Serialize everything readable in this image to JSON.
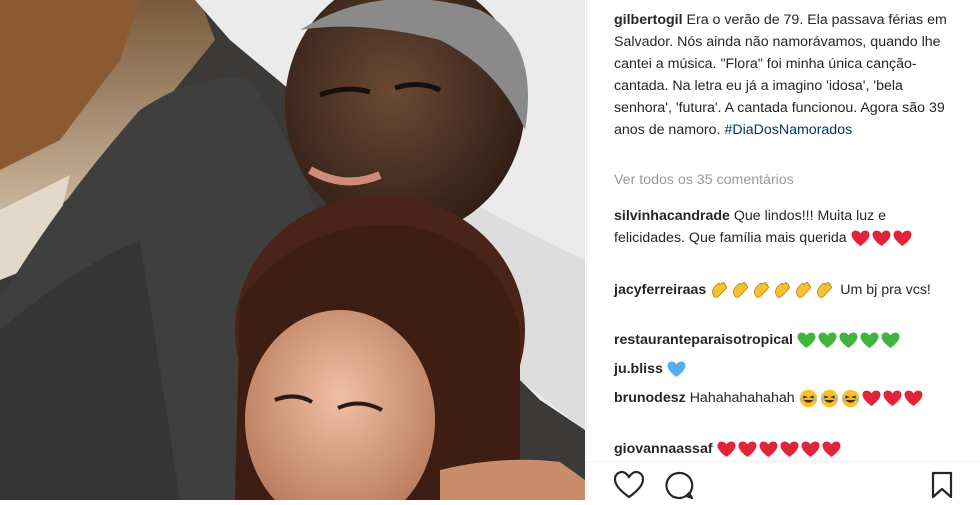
{
  "post": {
    "author": "gilbertogil",
    "caption": "Era o verão de 79. Ela passava férias em Salvador. Nós ainda não namorávamos, quando lhe cantei a música. \"Flora\" foi minha única canção-cantada. Na letra eu já a imagino 'idosa', 'bela senhora', 'futura'. A cantada funcionou. Agora são 39 anos de namoro.",
    "hashtag": "#DiaDosNamorados",
    "view_all_comments": "Ver todos os 35 comentários"
  },
  "comments": [
    {
      "user": "silvinhacandrade",
      "text": "Que lindos!!! Muita luz e felicidades. Que família mais querida",
      "emojis": [
        "red-heart",
        "red-heart",
        "red-heart"
      ]
    },
    {
      "user": "jacyferreiraas",
      "emojis_before": [
        "clapping-hands",
        "clapping-hands",
        "clapping-hands",
        "clapping-hands",
        "clapping-hands",
        "clapping-hands"
      ],
      "text": "Um bj pra vcs!"
    },
    {
      "user": "restauranteparaisotropical",
      "emojis": [
        "green-heart",
        "green-heart",
        "green-heart",
        "green-heart",
        "green-heart"
      ]
    },
    {
      "user": "ju.bliss",
      "emojis": [
        "blue-heart"
      ]
    },
    {
      "user": "brunodesz",
      "text": "Hahahahahahah",
      "emojis": [
        "laughing-face",
        "laughing-face",
        "laughing-face",
        "red-heart",
        "red-heart",
        "red-heart"
      ]
    },
    {
      "user": "giovannaassaf",
      "emojis": [
        "red-heart",
        "red-heart",
        "red-heart",
        "red-heart",
        "red-heart",
        "red-heart"
      ]
    }
  ],
  "actions": {
    "like": "heart-outline-icon",
    "comment": "speech-bubble-icon",
    "save": "bookmark-icon"
  },
  "colors": {
    "username": "#262626",
    "hashtag": "#003569",
    "muted": "#999999",
    "red_heart": "#e0243a",
    "green_heart": "#3fb53f",
    "blue_heart": "#55acee",
    "emoji_yellow": "#f8c131"
  }
}
